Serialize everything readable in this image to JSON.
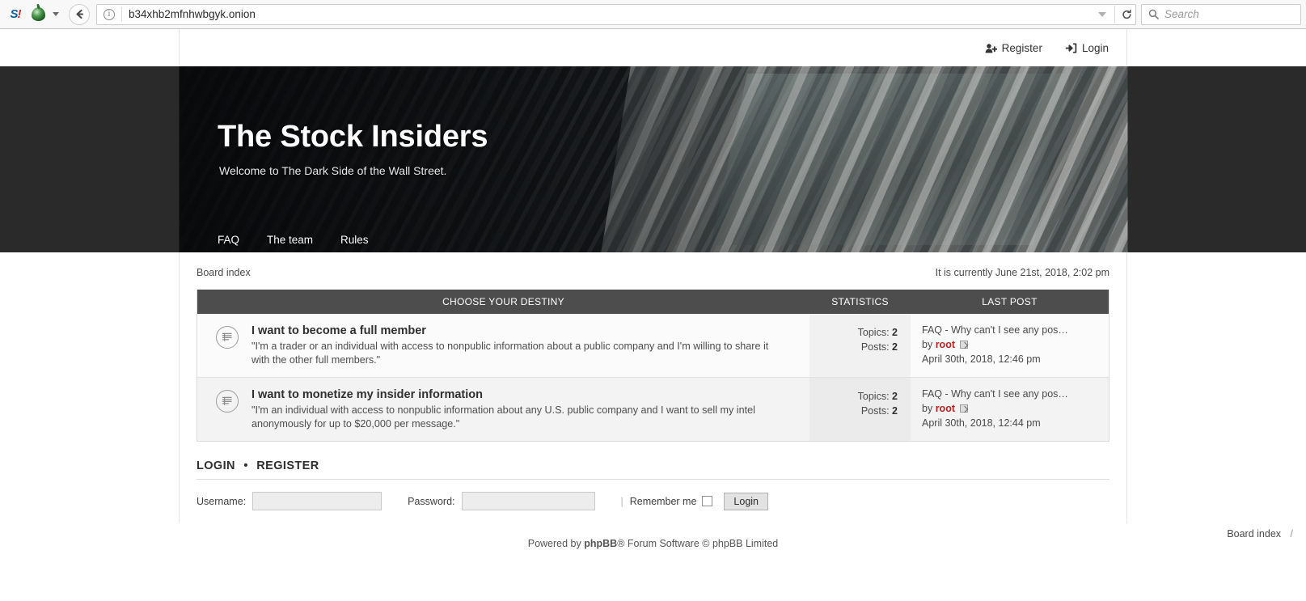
{
  "browser": {
    "extension_icon": "sentinel-s-icon",
    "onion_icon": "tor-onion-icon",
    "back_icon": "back-arrow-icon",
    "info_icon": "site-info-icon",
    "url": "b34xhb2mfnhwbgyk.onion",
    "reload_icon": "reload-icon",
    "search_placeholder": "Search",
    "search_icon": "search-icon"
  },
  "header": {
    "register_label": "Register",
    "login_label": "Login"
  },
  "hero": {
    "title": "The Stock Insiders",
    "subtitle": "Welcome to The Dark Side of the Wall Street.",
    "nav": [
      "FAQ",
      "The team",
      "Rules"
    ]
  },
  "breadcrumb": {
    "board_index": "Board index",
    "current_time": "It is currently June 21st, 2018, 2:02 pm"
  },
  "forum_table": {
    "headers": {
      "name": "CHOOSE YOUR DESTINY",
      "stats": "STATISTICS",
      "last_post": "LAST POST"
    },
    "rows": [
      {
        "icon": "forum-no-new-posts-icon",
        "title": "I want to become a full member",
        "description": "\"I'm a trader or an individual with access to nonpublic information about a public company and I'm willing to share it with the other full members.\"",
        "topics_label": "Topics:",
        "topics": "2",
        "posts_label": "Posts:",
        "posts": "2",
        "last_post_title": "FAQ - Why can't I see any pos…",
        "last_post_by_label": "by",
        "last_post_author": "root",
        "last_post_date": "April 30th, 2018, 12:46 pm"
      },
      {
        "icon": "forum-no-new-posts-icon",
        "title": "I want to monetize my insider information",
        "description": "\"I'm an individual with access to nonpublic information about any U.S. public company and I want to sell my intel anonymously for up to $20,000 per message.\"",
        "topics_label": "Topics:",
        "topics": "2",
        "posts_label": "Posts:",
        "posts": "2",
        "last_post_title": "FAQ - Why can't I see any pos…",
        "last_post_by_label": "by",
        "last_post_author": "root",
        "last_post_date": "April 30th, 2018, 12:44 pm"
      }
    ]
  },
  "login_section": {
    "heading_login": "LOGIN",
    "heading_separator": "•",
    "heading_register": "REGISTER",
    "username_label": "Username:",
    "username_value": "",
    "password_label": "Password:",
    "password_value": "",
    "separator": "|",
    "remember_label": "Remember me",
    "login_button": "Login"
  },
  "footer": {
    "powered_prefix": "Powered by ",
    "powered_brand": "phpBB",
    "powered_suffix": "® Forum Software © phpBB Limited",
    "board_index": "Board index",
    "slash": "/"
  },
  "colors": {
    "header_band": "#4d4d4d",
    "author_red": "#b92222",
    "hero_bg": "#1b1d20"
  }
}
